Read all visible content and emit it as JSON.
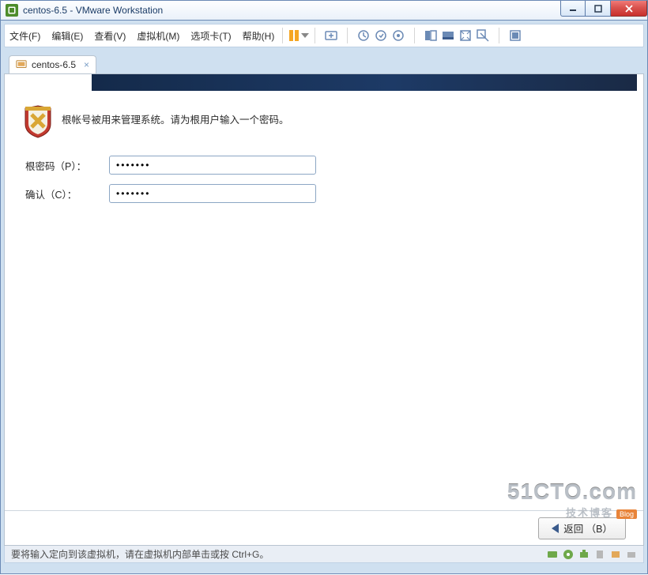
{
  "window": {
    "title": "centos-6.5 - VMware Workstation"
  },
  "menu": {
    "file": "文件(F)",
    "edit": "编辑(E)",
    "view": "查看(V)",
    "vm": "虚拟机(M)",
    "tabs": "选项卡(T)",
    "help": "帮助(H)"
  },
  "tab": {
    "label": "centos-6.5"
  },
  "installer": {
    "message": "根帐号被用来管理系统。请为根用户输入一个密码。",
    "root_pw_label": "根密码（P）：",
    "confirm_label": "确认（C）：",
    "root_pw_value": "•••••••",
    "confirm_value": "•••••••",
    "back_btn": "返回 （B）"
  },
  "statusbar": {
    "hint": "要将输入定向到该虚拟机，请在虚拟机内部单击或按 Ctrl+G。"
  },
  "watermark": {
    "big": "51CTO.com",
    "small": "技术博客",
    "blog": "Blog"
  }
}
